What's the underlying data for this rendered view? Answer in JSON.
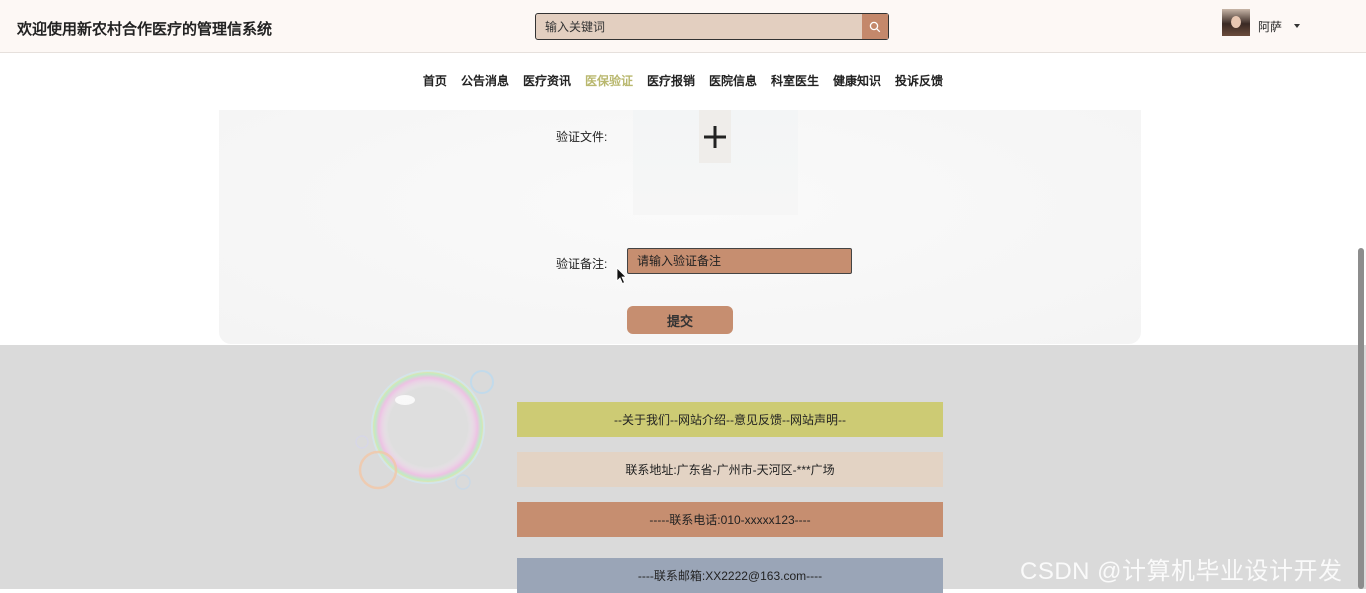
{
  "app_title": "欢迎使用新农村合作医疗的管理信系统",
  "search": {
    "placeholder": "输入关键词",
    "icon": "search-icon"
  },
  "user": {
    "name": "阿萨"
  },
  "nav": {
    "items": [
      "首页",
      "公告消息",
      "医疗资讯",
      "医保验证",
      "医疗报销",
      "医院信息",
      "科室医生",
      "健康知识",
      "投诉反馈"
    ],
    "active": "医保验证"
  },
  "form": {
    "file_label": "验证文件:",
    "note_label": "验证备注:",
    "note_placeholder": "请输入验证备注",
    "submit_label": "提交"
  },
  "footer": {
    "links": "--关于我们--网站介绍--意见反馈--网站声明--",
    "address": "联系地址:广东省-广州市-天河区-***广场",
    "phone": "-----联系电话:010-xxxxx123----",
    "email": "----联系邮箱:XX2222@163.com----"
  },
  "watermark": "CSDN @计算机毕业设计开发",
  "colors": {
    "accent": "#c68e70",
    "nav_active": "#b9b86f",
    "footer_links_bg": "#cdcb74",
    "footer_address_bg": "#e3d3c4",
    "footer_phone_bg": "#c68e70",
    "footer_email_bg": "#9aa5b7"
  }
}
